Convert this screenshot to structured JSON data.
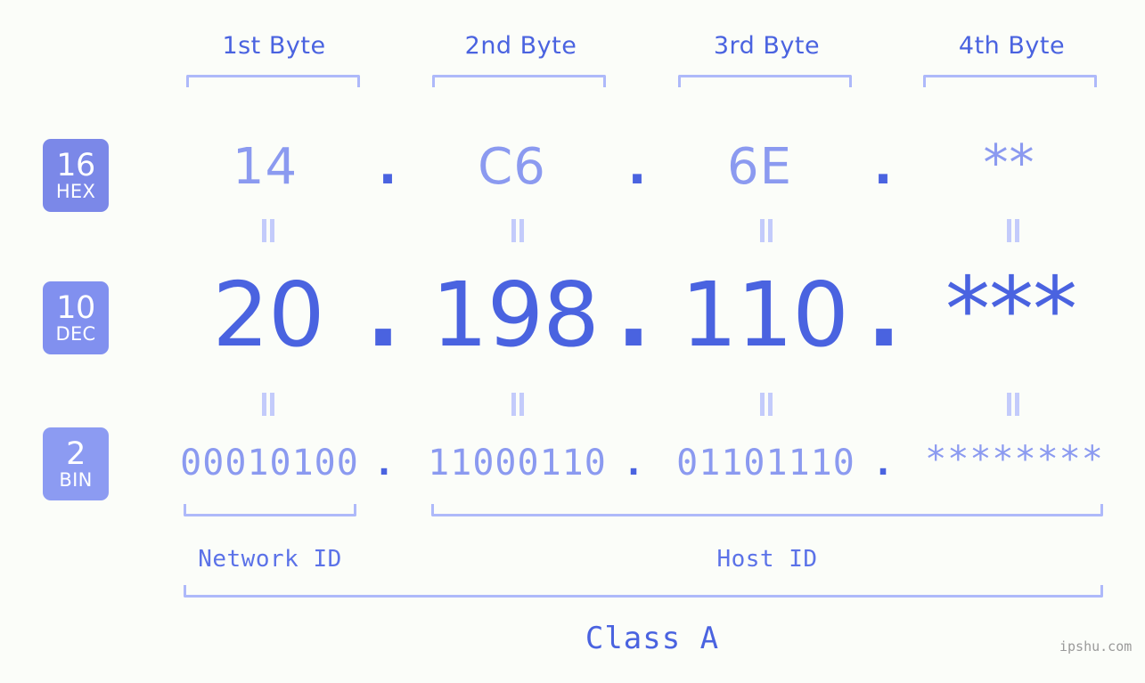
{
  "page": {
    "background_color": "#fbfdf9",
    "watermark": "ipshu.com"
  },
  "colors": {
    "header_blue": "#4a63e0",
    "light_blue": "#8b9af0",
    "bracket_blue": "#aeb9fa",
    "badge_blue": "#7b88e8",
    "badge_blue_light": "#8c9bf2",
    "eq_blue": "#c3cbfb",
    "watermark_gray": "#9a9a9a"
  },
  "byte_headers": [
    {
      "label": "1st Byte"
    },
    {
      "label": "2nd Byte"
    },
    {
      "label": "3rd Byte"
    },
    {
      "label": "4th Byte"
    }
  ],
  "bases": [
    {
      "number": "16",
      "name": "HEX"
    },
    {
      "number": "10",
      "name": "DEC"
    },
    {
      "number": "2",
      "name": "BIN"
    }
  ],
  "rows": {
    "hex": {
      "base_number": "16",
      "base_name": "HEX",
      "values": [
        "14",
        "C6",
        "6E",
        "**"
      ],
      "separator": "."
    },
    "dec": {
      "base_number": "10",
      "base_name": "DEC",
      "values": [
        "20",
        "198",
        "110",
        "***"
      ],
      "separator": "."
    },
    "bin": {
      "base_number": "2",
      "base_name": "BIN",
      "values": [
        "00010100",
        "11000110",
        "01101110",
        "********"
      ],
      "separator": "."
    }
  },
  "equality_marks": {
    "symbol": "=",
    "count_per_gap": 4,
    "gaps": 2
  },
  "segments": {
    "network_id": "Network ID",
    "host_id": "Host ID",
    "class": "Class A"
  },
  "ip_summary": {
    "hex": "14.C6.6E.**",
    "dec": "20.198.110.***",
    "bin": "00010100.11000110.01101110.********",
    "class": "Class A",
    "network_bytes": 1,
    "host_bytes": 3
  }
}
